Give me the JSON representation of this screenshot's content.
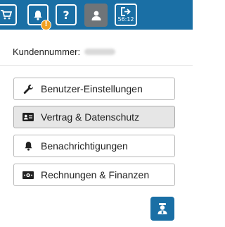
{
  "topbar": {
    "icons": [
      "cart-icon",
      "bell-icon",
      "question-icon",
      "user-icon",
      "logout-icon"
    ],
    "help_label": "?",
    "notification_badge": "!",
    "session_timer": "56:12",
    "accent_color": "#1a6fa5",
    "active_color": "#6f7478",
    "badge_color": "#f0a020"
  },
  "account": {
    "customer_number_label": "Kundennummer:"
  },
  "menu": {
    "items": [
      {
        "label": "Benutzer-Einstellungen",
        "icon": "wrench-icon"
      },
      {
        "label": "Vertrag & Datenschutz",
        "icon": "id-card-icon"
      },
      {
        "label": "Benachrichtigungen",
        "icon": "bell-icon"
      },
      {
        "label": "Rechnungen & Finanzen",
        "icon": "money-bill-icon"
      }
    ]
  },
  "bottom_button": {
    "icon": "support-agent-icon"
  }
}
